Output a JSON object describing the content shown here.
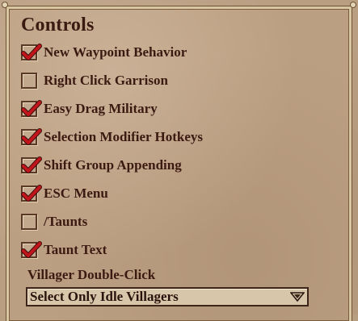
{
  "section": {
    "title": "Controls"
  },
  "options": [
    {
      "label": "New Waypoint Behavior",
      "checked": true
    },
    {
      "label": "Right Click Garrison",
      "checked": false
    },
    {
      "label": "Easy Drag Military",
      "checked": true
    },
    {
      "label": "Selection Modifier Hotkeys",
      "checked": true
    },
    {
      "label": "Shift Group Appending",
      "checked": true
    },
    {
      "label": "ESC Menu",
      "checked": true
    },
    {
      "label": "/Taunts",
      "checked": false
    },
    {
      "label": "Taunt Text",
      "checked": true
    }
  ],
  "villager_double_click": {
    "label": "Villager Double-Click",
    "selected": "Select Only Idle Villagers"
  },
  "colors": {
    "text": "#3b1a12",
    "check": "#c0151a",
    "panel": "#bb9f82",
    "border_light": "#d9c7a4"
  },
  "icons": {
    "check": "checkmark-icon",
    "dropdown": "chevron-down-icon"
  }
}
